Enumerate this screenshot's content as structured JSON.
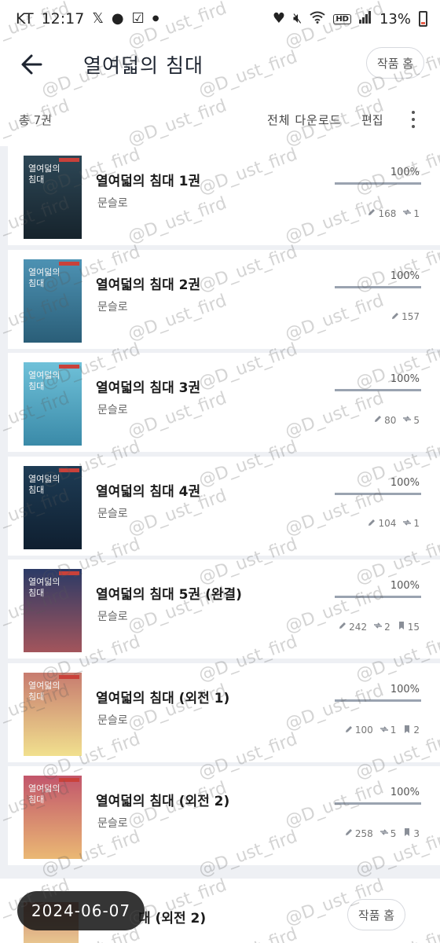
{
  "status_bar": {
    "carrier": "KT",
    "time": "12:17",
    "battery": "13%",
    "left_icons": [
      "x-logo-icon",
      "chat-bubble-icon",
      "checkbox-icon",
      "dot-icon"
    ],
    "right_icons": [
      "heart-icon",
      "silent-icon",
      "wifi-icon",
      "hd-icon",
      "signal-icon",
      "battery-icon"
    ],
    "hd_label": "HD"
  },
  "header": {
    "title": "열여덟의 침대",
    "home_button": "작품 홈"
  },
  "toolbar": {
    "total": "총 7권",
    "download_all": "전체 다운로드",
    "edit": "편집"
  },
  "books": [
    {
      "title": "열여덟의 침대 1권",
      "author": "문슬로",
      "percent": "100%",
      "progress": 1.0,
      "cover_title": "열여덟의\n침대",
      "cover_top": "#2d4756",
      "cover_bottom": "#16232c",
      "stats": [
        {
          "icon": "pencil-icon",
          "value": "168"
        },
        {
          "icon": "share-icon",
          "value": "1"
        }
      ]
    },
    {
      "title": "열여덟의 침대 2권",
      "author": "문슬로",
      "percent": "100%",
      "progress": 1.0,
      "cover_title": "열여덟의\n침대",
      "cover_top": "#4d92b3",
      "cover_bottom": "#2a5e78",
      "stats": [
        {
          "icon": "pencil-icon",
          "value": "157"
        }
      ]
    },
    {
      "title": "열여덟의 침대 3권",
      "author": "문슬로",
      "percent": "100%",
      "progress": 1.0,
      "cover_title": "열여덟의\n침대",
      "cover_top": "#6fc1d9",
      "cover_bottom": "#3a8aa8",
      "stats": [
        {
          "icon": "pencil-icon",
          "value": "80"
        },
        {
          "icon": "share-icon",
          "value": "5"
        }
      ]
    },
    {
      "title": "열여덟의 침대 4권",
      "author": "문슬로",
      "percent": "100%",
      "progress": 1.0,
      "cover_title": "열여덟의\n침대",
      "cover_top": "#1e3c55",
      "cover_bottom": "#0f1f30",
      "stats": [
        {
          "icon": "pencil-icon",
          "value": "104"
        },
        {
          "icon": "share-icon",
          "value": "1"
        }
      ]
    },
    {
      "title": "열여덟의 침대 5권 (완결)",
      "author": "문슬로",
      "percent": "100%",
      "progress": 1.0,
      "cover_title": "열여덟의\n침대",
      "cover_top": "#2b3a66",
      "cover_bottom": "#a3555c",
      "stats": [
        {
          "icon": "pencil-icon",
          "value": "242"
        },
        {
          "icon": "share-icon",
          "value": "2"
        },
        {
          "icon": "bookmark-icon",
          "value": "15"
        }
      ]
    },
    {
      "title": "열여덟의 침대 (외전 1)",
      "author": "문슬로",
      "percent": "100%",
      "progress": 1.0,
      "cover_title": "열여덟의\n침대",
      "cover_top": "#c77b6f",
      "cover_bottom": "#f1e08e",
      "stats": [
        {
          "icon": "pencil-icon",
          "value": "100"
        },
        {
          "icon": "share-icon",
          "value": "1"
        },
        {
          "icon": "bookmark-icon",
          "value": "2"
        }
      ]
    },
    {
      "title": "열여덟의 침대 (외전 2)",
      "author": "문슬로",
      "percent": "100%",
      "progress": 1.0,
      "cover_title": "열여덟의\n침대",
      "cover_top": "#c2566b",
      "cover_bottom": "#eab874",
      "stats": [
        {
          "icon": "pencil-icon",
          "value": "258"
        },
        {
          "icon": "share-icon",
          "value": "5"
        },
        {
          "icon": "bookmark-icon",
          "value": "3"
        }
      ]
    }
  ],
  "bottom": {
    "partial_title": "대 (외전 2)",
    "home_button": "작품 홈",
    "date_chip": "2024-06-07"
  },
  "watermark": "@D_ust_fird"
}
